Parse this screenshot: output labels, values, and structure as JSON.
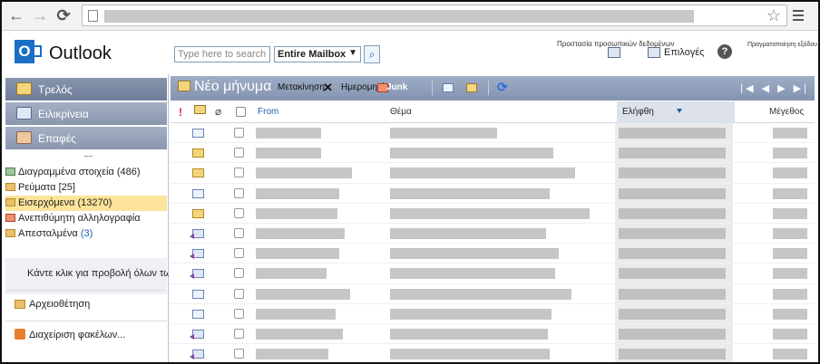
{
  "browser": {
    "back": "←",
    "forward": "→",
    "reload": "⟳",
    "bookmark": "☆"
  },
  "header": {
    "app_name": "Outlook",
    "logo_letter": "O",
    "search_placeholder": "Type here to search",
    "search_scope": "Entire Mailbox",
    "data_protection": "Προστασία προσωπικών δεδομένων",
    "options": "Επιλογές",
    "help": "?",
    "signout": "Πραγματοποίηση εξόδου"
  },
  "sidebar": {
    "nav": [
      {
        "label": "Τρελός",
        "icon": "mail-icon",
        "color": "#f5d57b"
      },
      {
        "label": "Ειλικρίνεια",
        "icon": "calendar-icon",
        "color": "#e0e8f5"
      },
      {
        "label": "Επαφές",
        "icon": "contacts-icon",
        "color": "#f0c8a0"
      }
    ],
    "grip": "........",
    "folders": [
      {
        "name": "Διαγραμμένα στοιχεία",
        "count": "(486)"
      },
      {
        "name": "Ρεύματα",
        "count": "[25]"
      },
      {
        "name": "Εισερχόμενα",
        "count": "(13270)"
      },
      {
        "name": "Ανεπιθύμητη αλληλογραφία",
        "count": ""
      },
      {
        "name": "Απεσταλμένα",
        "count": "(3)"
      }
    ],
    "all_folders": "Κάντε κλικ για προβολή όλων των φακέλων",
    "archive": "Αρχειοθέτηση",
    "manage_folders": "Διαχείριση φακέλων..."
  },
  "toolbar": {
    "new_message": "Νέο μήνυμα",
    "move": "Μετακίνηση",
    "date": "Ημερομηνία",
    "junk": "Junk",
    "pager": "|◀ ◀ ▶ ▶|"
  },
  "grid": {
    "importance": "!",
    "attachment": "⌀",
    "from": "From",
    "subject": "Θέμα",
    "received": "Ελήφθη",
    "size": "Μέγεθος"
  },
  "messages": [
    {
      "icon": "read"
    },
    {
      "icon": "unread"
    },
    {
      "icon": "unread"
    },
    {
      "icon": "read"
    },
    {
      "icon": "unread"
    },
    {
      "icon": "reply"
    },
    {
      "icon": "reply"
    },
    {
      "icon": "reply"
    },
    {
      "icon": "read"
    },
    {
      "icon": "read"
    },
    {
      "icon": "reply"
    },
    {
      "icon": "reply"
    }
  ]
}
